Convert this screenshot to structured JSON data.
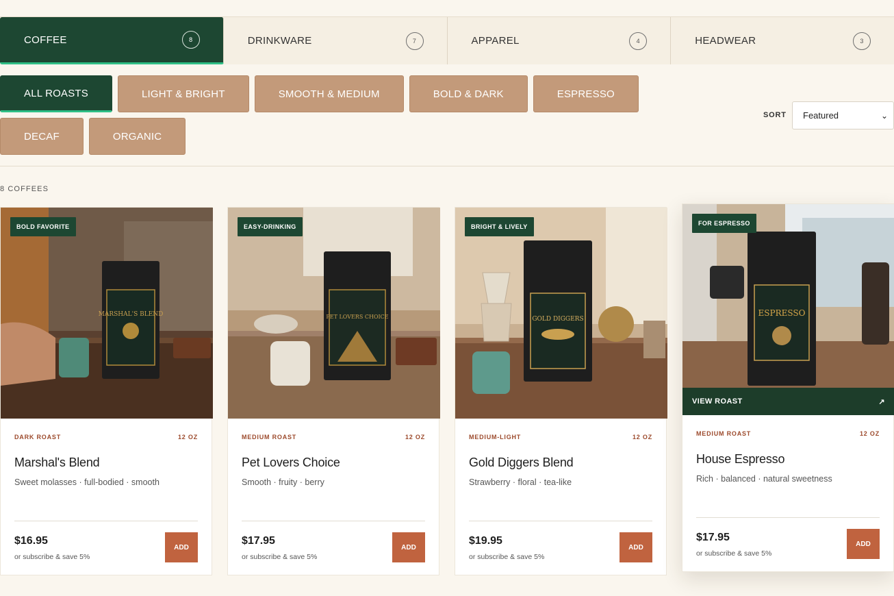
{
  "tabs": [
    {
      "label": "COFFEE",
      "count": "8"
    },
    {
      "label": "DRINKWARE",
      "count": "7"
    },
    {
      "label": "APPAREL",
      "count": "4"
    },
    {
      "label": "HEADWEAR",
      "count": "3"
    }
  ],
  "filters": [
    "ALL ROASTS",
    "LIGHT & BRIGHT",
    "SMOOTH & MEDIUM",
    "BOLD & DARK",
    "ESPRESSO",
    "DECAF",
    "ORGANIC"
  ],
  "sort": {
    "label": "SORT",
    "value": "Featured"
  },
  "result_count": "8 COFFEES",
  "products": [
    {
      "badge": "BOLD FAVORITE",
      "roast": "DARK ROAST",
      "size": "12 OZ",
      "name": "Marshal's Blend",
      "notes": "Sweet molasses · full-bodied · smooth",
      "price": "$16.95",
      "subscribe": "or subscribe & save 5%",
      "add": "ADD",
      "bag_label": "MARSHAL'S BLEND"
    },
    {
      "badge": "EASY-DRINKING",
      "roast": "MEDIUM ROAST",
      "size": "12 OZ",
      "name": "Pet Lovers Choice",
      "notes": "Smooth · fruity · berry",
      "price": "$17.95",
      "subscribe": "or subscribe & save 5%",
      "add": "ADD",
      "bag_label": "PET LOVERS CHOICE"
    },
    {
      "badge": "BRIGHT & LIVELY",
      "roast": "MEDIUM-LIGHT",
      "size": "12 OZ",
      "name": "Gold Diggers Blend",
      "notes": "Strawberry · floral · tea-like",
      "price": "$19.95",
      "subscribe": "or subscribe & save 5%",
      "add": "ADD",
      "bag_label": "GOLD DIGGERS"
    },
    {
      "badge": "FOR ESPRESSO",
      "roast": "MEDIUM ROAST",
      "size": "12 OZ",
      "name": "House Espresso",
      "notes": "Rich · balanced · natural sweetness",
      "price": "$17.95",
      "subscribe": "or subscribe & save 5%",
      "add": "ADD",
      "bag_label": "ESPRESSO",
      "view_label": "VIEW ROAST",
      "view_icon": "↗"
    }
  ]
}
